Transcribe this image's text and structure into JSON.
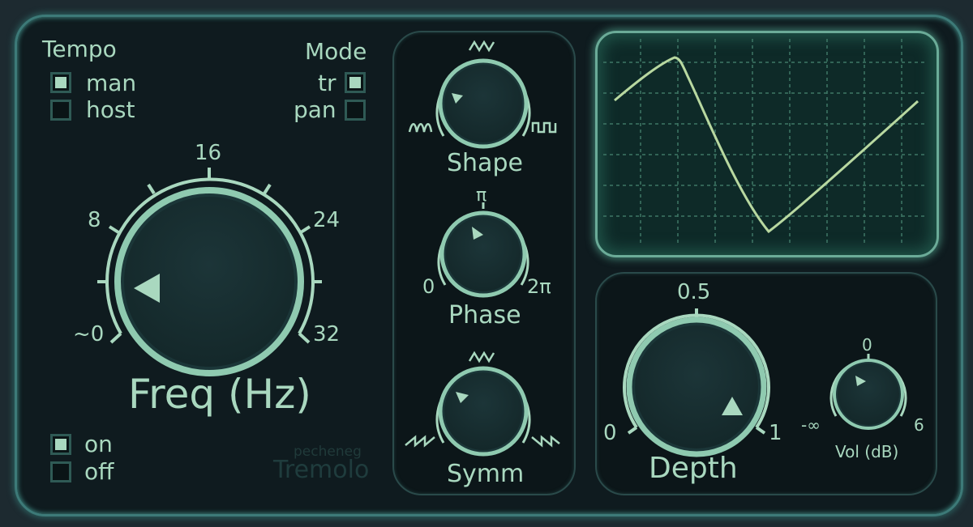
{
  "plugin": {
    "brand": "pecheneg",
    "name": "Tremolo"
  },
  "tempo": {
    "title": "Tempo",
    "options": [
      {
        "label": "man",
        "checked": true
      },
      {
        "label": "host",
        "checked": false
      }
    ]
  },
  "mode": {
    "title": "Mode",
    "options": [
      {
        "label": "tr",
        "checked": true
      },
      {
        "label": "pan",
        "checked": false
      }
    ]
  },
  "power": {
    "options": [
      {
        "label": "on",
        "checked": true
      },
      {
        "label": "off",
        "checked": false
      }
    ]
  },
  "freq": {
    "label": "Freq (Hz)",
    "ticks": {
      "min": "~0",
      "t8": "8",
      "t16": "16",
      "t24": "24",
      "max": "32"
    }
  },
  "shape": {
    "label": "Shape",
    "ticks": {
      "top": "triangle-wave-icon",
      "left": "sine-wave-icon",
      "right": "square-wave-icon"
    }
  },
  "phase": {
    "label": "Phase",
    "ticks": {
      "min": "0",
      "top": "π",
      "max": "2π"
    }
  },
  "symm": {
    "label": "Symm",
    "ticks": {
      "top": "triangle-wave-icon",
      "left": "ramp-up-icon",
      "right": "ramp-down-icon"
    }
  },
  "depth": {
    "label": "Depth",
    "ticks": {
      "min": "0",
      "mid": "0.5",
      "max": "1"
    }
  },
  "vol": {
    "label": "Vol (dB)",
    "ticks": {
      "min": "-∞",
      "mid": "0",
      "max": "6"
    }
  },
  "colors": {
    "accent": "#a9d8bf",
    "background": "#0f1b1f",
    "frame": "#3d7a78",
    "scope_line": "#b8d8a0"
  }
}
